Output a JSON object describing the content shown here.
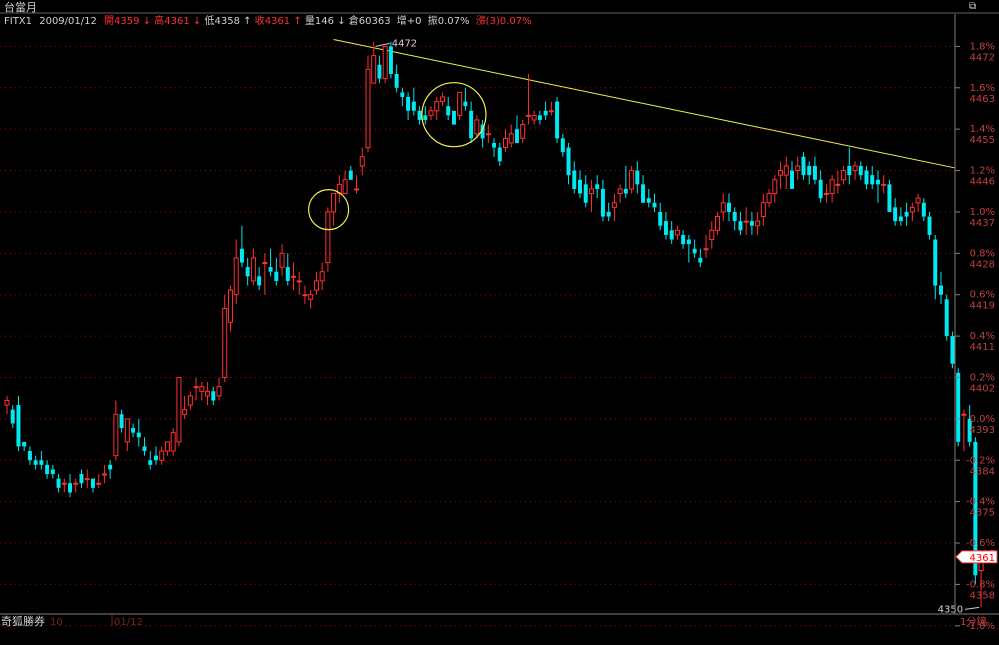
{
  "window": {
    "title": "台當月"
  },
  "quote": {
    "symbol": "FITX1",
    "date": "2009/01/12",
    "open": "開4359",
    "high": "高4361",
    "low": "低4358",
    "close": "收4361",
    "volume": "量146",
    "open_interest": "倉60363",
    "oi_change": "增+0",
    "amplitude": "振0.07%",
    "change": "漲(3)0.07%"
  },
  "footer": {
    "indicator": "奇狐勝券",
    "indicator_value": "10",
    "date_label": "01/12",
    "period": "1分鐘"
  },
  "colors": {
    "up": "#ff3030",
    "down": "#00e8f0",
    "trendline": "#f0f050",
    "circle": "#f0f050",
    "grid": "#a00000",
    "axis_text": "#c04040"
  },
  "chart_data": {
    "type": "candlestick",
    "title": "",
    "xlabel": "",
    "ylabel": "",
    "ylim": [
      4349,
      4476
    ],
    "last_price": "4361",
    "ref_price": 4358,
    "right_axis": [
      {
        "pct": "1.8%",
        "price": "4472",
        "y": 4472
      },
      {
        "pct": "1.6%",
        "price": "4463",
        "y": 4463
      },
      {
        "pct": "1.4%",
        "price": "4455",
        "y": 4454
      },
      {
        "pct": "1.2%",
        "price": "4446",
        "y": 4445
      },
      {
        "pct": "1.0%",
        "price": "4437",
        "y": 4436
      },
      {
        "pct": "0.8%",
        "price": "4428",
        "y": 4427
      },
      {
        "pct": "0.6%",
        "price": "4419",
        "y": 4418
      },
      {
        "pct": "0.4%",
        "price": "4411",
        "y": 4409
      },
      {
        "pct": "0.2%",
        "price": "4402",
        "y": 4400
      },
      {
        "pct": "0.0%",
        "price": "4393",
        "y": 4391
      },
      {
        "pct": "-0.2%",
        "price": "4384",
        "y": 4382
      },
      {
        "pct": "-0.4%",
        "price": "4375",
        "y": 4373
      },
      {
        "pct": "-0.6%",
        "price": "4367",
        "y": 4364
      },
      {
        "pct": "-0.8%",
        "price": "4358",
        "y": 4355
      },
      {
        "pct": "-1.0%",
        "price": "",
        "y": 4346
      }
    ],
    "annotations": {
      "high_label": "4472",
      "high_value": 4472,
      "low_label": "4350",
      "low_value": 4350
    },
    "trendline": [
      [
        57,
        4473.5
      ],
      [
        156,
        4448
      ]
    ],
    "circles": [
      57,
      78
    ],
    "candles": [
      [
        4394,
        4396,
        4392,
        4395
      ],
      [
        4393,
        4394,
        4389,
        4390
      ],
      [
        4394,
        4396,
        4384,
        4385
      ],
      [
        4386,
        4386,
        4384,
        4385
      ],
      [
        4384,
        4385,
        4381,
        4382
      ],
      [
        4382,
        4383,
        4380,
        4381
      ],
      [
        4382,
        4384,
        4380,
        4381
      ],
      [
        4381,
        4382,
        4378,
        4379
      ],
      [
        4380,
        4381,
        4378,
        4379
      ],
      [
        4378,
        4379,
        4375,
        4376
      ],
      [
        4377,
        4378,
        4375,
        4377
      ],
      [
        4377,
        4379,
        4374,
        4375
      ],
      [
        4377,
        4378,
        4375,
        4377
      ],
      [
        4379,
        4380,
        4376,
        4377
      ],
      [
        4378,
        4380,
        4376,
        4378
      ],
      [
        4378,
        4378,
        4375,
        4376
      ],
      [
        4377,
        4379,
        4376,
        4377
      ],
      [
        4379,
        4381,
        4377,
        4379
      ],
      [
        4381,
        4382,
        4378,
        4380
      ],
      [
        4383,
        4395,
        4382,
        4392
      ],
      [
        4392,
        4393,
        4388,
        4389
      ],
      [
        4386,
        4391,
        4384,
        4391
      ],
      [
        4389,
        4390,
        4387,
        4388
      ],
      [
        4388,
        4391,
        4385,
        4387
      ],
      [
        4385,
        4387,
        4383,
        4384
      ],
      [
        4382,
        4384,
        4380,
        4381
      ],
      [
        4383,
        4385,
        4381,
        4382
      ],
      [
        4382,
        4385,
        4381,
        4384
      ],
      [
        4384,
        4386,
        4383,
        4386
      ],
      [
        4384,
        4389,
        4383,
        4388
      ],
      [
        4386,
        4400,
        4385,
        4400
      ],
      [
        4392,
        4396,
        4391,
        4393
      ],
      [
        4394,
        4397,
        4393,
        4396
      ],
      [
        4398,
        4400,
        4395,
        4398
      ],
      [
        4397,
        4399,
        4395,
        4398
      ],
      [
        4396,
        4399,
        4394,
        4397
      ],
      [
        4397,
        4398,
        4394,
        4395
      ],
      [
        4396,
        4400,
        4395,
        4398
      ],
      [
        4400,
        4418,
        4399,
        4415
      ],
      [
        4412,
        4420,
        4410,
        4419
      ],
      [
        4418,
        4430,
        4416,
        4426
      ],
      [
        4428,
        4433,
        4424,
        4425
      ],
      [
        4424,
        4426,
        4420,
        4422
      ],
      [
        4421,
        4428,
        4420,
        4426
      ],
      [
        4422,
        4424,
        4419,
        4420
      ],
      [
        4425,
        4427,
        4418,
        4425
      ],
      [
        4424,
        4428,
        4422,
        4423
      ],
      [
        4423,
        4426,
        4420,
        4421
      ],
      [
        4424,
        4429,
        4422,
        4427
      ],
      [
        4424,
        4427,
        4420,
        4421
      ],
      [
        4422,
        4425,
        4419,
        4422
      ],
      [
        4421,
        4423,
        4418,
        4421
      ],
      [
        4418,
        4420,
        4416,
        4418
      ],
      [
        4417,
        4419,
        4415,
        4418
      ],
      [
        4419,
        4423,
        4418,
        4421
      ],
      [
        4421,
        4425,
        4419,
        4423
      ],
      [
        4425,
        4437,
        4423,
        4436
      ],
      [
        4436,
        4440,
        4433,
        4440
      ],
      [
        4440,
        4444,
        4438,
        4442
      ],
      [
        4440,
        4445,
        4440,
        4443
      ],
      [
        4445,
        4446,
        4443,
        4443
      ],
      [
        4441,
        4444,
        4440,
        4441
      ],
      [
        4446,
        4450,
        4444,
        4448
      ],
      [
        4450,
        4470,
        4449,
        4467
      ],
      [
        4464,
        4473,
        4464,
        4470
      ],
      [
        4468,
        4470,
        4464,
        4465
      ],
      [
        4465,
        4472,
        4464,
        4472
      ],
      [
        4472,
        4473,
        4465,
        4466
      ],
      [
        4466,
        4468,
        4462,
        4463
      ],
      [
        4462,
        4463,
        4459,
        4461
      ],
      [
        4461,
        4462,
        4456,
        4458
      ],
      [
        4460,
        4463,
        4457,
        4458
      ],
      [
        4458,
        4459,
        4455,
        4456
      ],
      [
        4457,
        4459,
        4455,
        4456
      ],
      [
        4457,
        4459,
        4456,
        4458
      ],
      [
        4458,
        4461,
        4456,
        4460
      ],
      [
        4460,
        4462,
        4459,
        4461
      ],
      [
        4459,
        4461,
        4456,
        4457
      ],
      [
        4458,
        4458,
        4455,
        4455
      ],
      [
        4457,
        4462,
        4456,
        4462
      ],
      [
        4460,
        4463,
        4458,
        4459
      ],
      [
        4458,
        4460,
        4451,
        4452
      ],
      [
        4453,
        4457,
        4452,
        4456
      ],
      [
        4455,
        4456,
        4450,
        4452
      ],
      [
        4453,
        4455,
        4451,
        4453
      ],
      [
        4451,
        4452,
        4448,
        4450
      ],
      [
        4450,
        4451,
        4446,
        4447
      ],
      [
        4450,
        4454,
        4449,
        4452
      ],
      [
        4451,
        4455,
        4450,
        4453
      ],
      [
        4454,
        4457,
        4451,
        4451
      ],
      [
        4452,
        4456,
        4451,
        4455
      ],
      [
        4457,
        4466,
        4455,
        4457
      ],
      [
        4456,
        4458,
        4455,
        4457
      ],
      [
        4457,
        4458,
        4455,
        4456
      ],
      [
        4458,
        4460,
        4456,
        4457
      ],
      [
        4458,
        4460,
        4457,
        4458
      ],
      [
        4460,
        4461,
        4451,
        4452
      ],
      [
        4452,
        4453,
        4448,
        4449
      ],
      [
        4450,
        4451,
        4442,
        4444
      ],
      [
        4445,
        4447,
        4440,
        4441
      ],
      [
        4443,
        4445,
        4439,
        4440
      ],
      [
        4442,
        4444,
        4437,
        4438
      ],
      [
        4440,
        4443,
        4436,
        4441
      ],
      [
        4442,
        4444,
        4439,
        4441
      ],
      [
        4441,
        4443,
        4434,
        4435
      ],
      [
        4436,
        4438,
        4434,
        4435
      ],
      [
        4437,
        4440,
        4434,
        4438
      ],
      [
        4440,
        4442,
        4438,
        4441
      ],
      [
        4441,
        4446,
        4439,
        4440
      ],
      [
        4441,
        4446,
        4440,
        4445
      ],
      [
        4445,
        4447,
        4440,
        4442
      ],
      [
        4442,
        4444,
        4438,
        4438
      ],
      [
        4439,
        4441,
        4437,
        4438
      ],
      [
        4438,
        4440,
        4436,
        4437
      ],
      [
        4436,
        4438,
        4432,
        4433
      ],
      [
        4434,
        4436,
        4430,
        4431
      ],
      [
        4432,
        4434,
        4429,
        4430
      ],
      [
        4431,
        4433,
        4430,
        4432
      ],
      [
        4431,
        4432,
        4428,
        4429
      ],
      [
        4430,
        4431,
        4425,
        4429
      ],
      [
        4428,
        4430,
        4426,
        4427
      ],
      [
        4426,
        4428,
        4424,
        4425
      ],
      [
        4428,
        4431,
        4426,
        4428
      ],
      [
        4430,
        4434,
        4428,
        4432
      ],
      [
        4432,
        4436,
        4431,
        4435
      ],
      [
        4436,
        4440,
        4434,
        4438
      ],
      [
        4438,
        4440,
        4434,
        4436
      ],
      [
        4436,
        4437,
        4432,
        4434
      ],
      [
        4434,
        4436,
        4431,
        4432
      ],
      [
        4434,
        4437,
        4431,
        4434
      ],
      [
        4434,
        4436,
        4431,
        4433
      ],
      [
        4433,
        4436,
        4431,
        4434
      ],
      [
        4435,
        4440,
        4433,
        4438
      ],
      [
        4438,
        4441,
        4437,
        4440
      ],
      [
        4440,
        4444,
        4438,
        4443
      ],
      [
        4444,
        4447,
        4441,
        4445
      ],
      [
        4444,
        4448,
        4441,
        4446
      ],
      [
        4445,
        4447,
        4441,
        4441
      ],
      [
        4445,
        4448,
        4443,
        4446
      ],
      [
        4448,
        4449,
        4443,
        4444
      ],
      [
        4446,
        4447,
        4442,
        4444
      ],
      [
        4446,
        4448,
        4442,
        4443
      ],
      [
        4443,
        4445,
        4438,
        4439
      ],
      [
        4440,
        4442,
        4438,
        4440
      ],
      [
        4440,
        4444,
        4438,
        4443
      ],
      [
        4442,
        4445,
        4440,
        4442
      ],
      [
        4443,
        4446,
        4442,
        4445
      ],
      [
        4446,
        4450,
        4442,
        4444
      ],
      [
        4445,
        4447,
        4443,
        4446
      ],
      [
        4446,
        4447,
        4443,
        4444
      ],
      [
        4445,
        4446,
        4441,
        4442
      ],
      [
        4444,
        4446,
        4441,
        4442
      ],
      [
        4443,
        4445,
        4438,
        4442
      ],
      [
        4442,
        4444,
        4440,
        4442
      ],
      [
        4442,
        4443,
        4436,
        4436
      ],
      [
        4437,
        4439,
        4433,
        4434
      ],
      [
        4435,
        4437,
        4433,
        4434
      ],
      [
        4436,
        4438,
        4433,
        4435
      ],
      [
        4436,
        4438,
        4434,
        4437
      ],
      [
        4438,
        4440,
        4436,
        4439
      ],
      [
        4438,
        4439,
        4434,
        4435
      ],
      [
        4435,
        4436,
        4430,
        4431
      ],
      [
        4430,
        4431,
        4417,
        4420
      ],
      [
        4420,
        4423,
        4416,
        4418
      ],
      [
        4417,
        4418,
        4408,
        4409
      ],
      [
        4409,
        4410,
        4402,
        4403
      ],
      [
        4401,
        4402,
        4385,
        4386
      ],
      [
        4392,
        4393,
        4384,
        4392
      ],
      [
        4391,
        4394,
        4385,
        4386
      ],
      [
        4386,
        4387,
        4355,
        4357
      ],
      [
        4358,
        4361,
        4350,
        4361
      ]
    ]
  }
}
